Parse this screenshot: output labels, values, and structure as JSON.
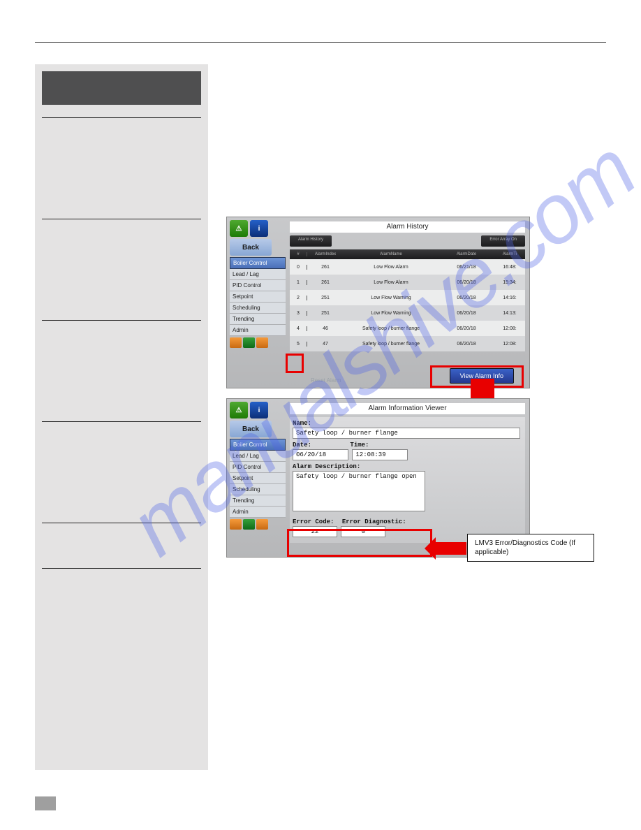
{
  "watermark": "manualshive.com",
  "callout": "LMV3 Error/Diagnostics Code (If applicable)",
  "panel1": {
    "title": "Alarm History",
    "tab_left": "Alarm History",
    "tab_right": "Error Array On",
    "back": "Back",
    "nav_header": "Boiler Control",
    "nav": [
      "Lead / Lag",
      "PID Control",
      "Setpoint",
      "Scheduling",
      "Trending",
      "Admin"
    ],
    "cols": {
      "n": "#",
      "idx": "AlarmIndex",
      "name": "AlarmName",
      "date": "AlarmDate",
      "time": "AlarmTi"
    },
    "rows": [
      {
        "n": "0",
        "idx": "261",
        "name": "Low Flow Alarm",
        "date": "06/21/18",
        "time": "16:48:"
      },
      {
        "n": "1",
        "idx": "261",
        "name": "Low Flow Alarm",
        "date": "06/20/18",
        "time": "15:34:"
      },
      {
        "n": "2",
        "idx": "251",
        "name": "Low Flow Warning",
        "date": "06/20/18",
        "time": "14:16:"
      },
      {
        "n": "3",
        "idx": "251",
        "name": "Low Flow Warning",
        "date": "06/20/18",
        "time": "14:13:"
      },
      {
        "n": "4",
        "idx": "46",
        "name": "Safety loop / burner flange",
        "date": "06/20/18",
        "time": "12:08:"
      },
      {
        "n": "5",
        "idx": "47",
        "name": "Safety loop / burner flange",
        "date": "06/20/18",
        "time": "12:08:"
      }
    ],
    "reset": "Reset Alarm",
    "view": "View Alarm Info"
  },
  "panel2": {
    "title": "Alarm Information Viewer",
    "back": "Back",
    "nav_header": "Boiler Control",
    "nav": [
      "Lead / Lag",
      "PID Control",
      "Setpoint",
      "Scheduling",
      "Trending",
      "Admin"
    ],
    "name_lbl": "Name:",
    "name_val": "Safety loop / burner flange",
    "date_lbl": "Date:",
    "date_val": "06/20/18",
    "time_lbl": "Time:",
    "time_val": "12:08:39",
    "desc_lbl": "Alarm Description:",
    "desc_val": "Safety loop / burner flange open",
    "err_lbl": "Error Code:",
    "err_val": "22",
    "diag_lbl": "Error Diagnostic:",
    "diag_val": "0"
  }
}
